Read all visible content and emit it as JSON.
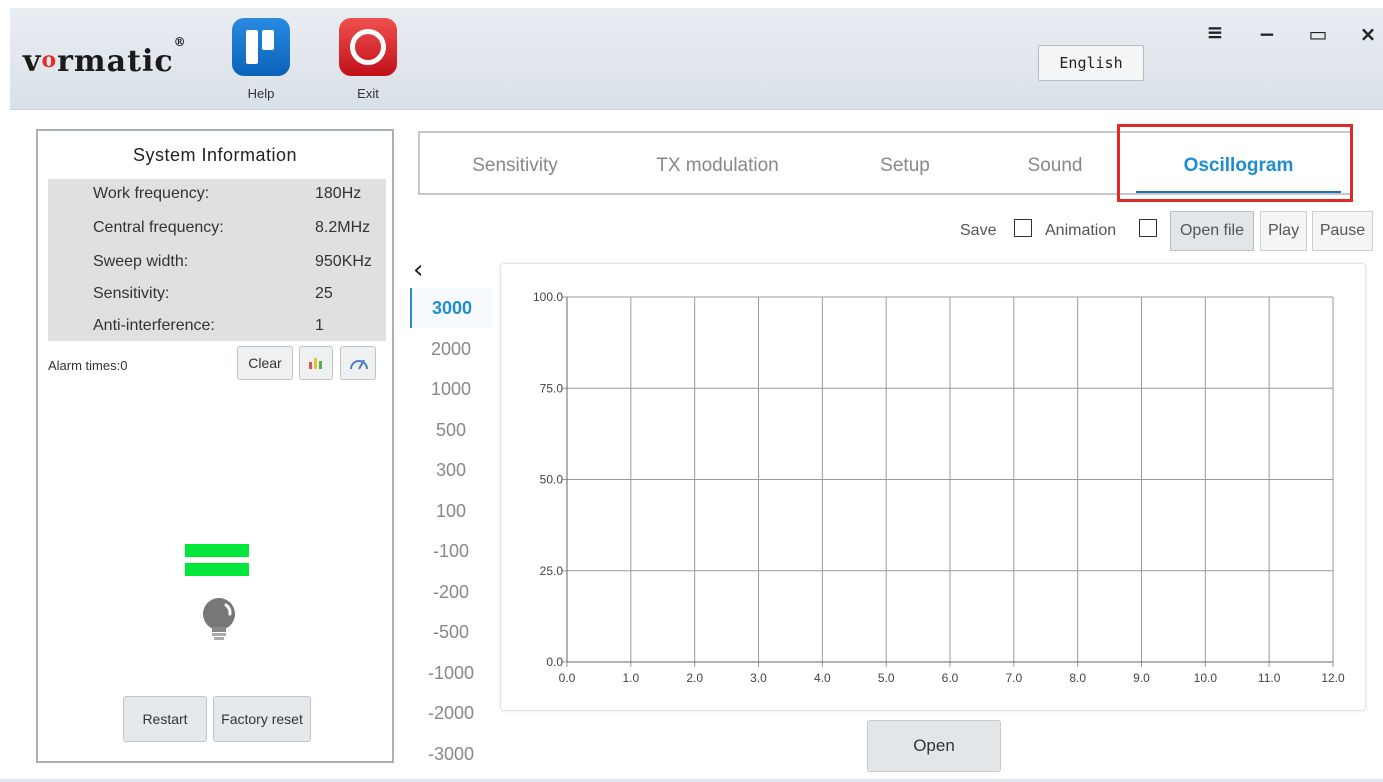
{
  "brand": {
    "logo_text": "vormatic",
    "logo_dot": "o",
    "logo_mark": "®"
  },
  "header": {
    "help_label": "Help",
    "exit_label": "Exit",
    "language": "English",
    "menu_icon": "≡",
    "minimize_icon": "−",
    "maximize_icon": "▭",
    "close_icon": "×"
  },
  "system_info": {
    "title": "System Information",
    "rows": [
      {
        "label": "Work frequency:",
        "value": "180Hz"
      },
      {
        "label": "Central frequency:",
        "value": "8.2MHz"
      },
      {
        "label": "Sweep width:",
        "value": "950KHz"
      },
      {
        "label": "Sensitivity:",
        "value": "25"
      },
      {
        "label": "Anti-interference:",
        "value": "1"
      }
    ],
    "alarm_times": "Alarm times:0",
    "clear_label": "Clear",
    "status_indicator_color": "#00e63a",
    "restart_label": "Restart",
    "factory_reset_label": "Factory reset"
  },
  "tabs": [
    {
      "label": "Sensitivity",
      "active": false
    },
    {
      "label": "TX modulation",
      "active": false
    },
    {
      "label": "Setup",
      "active": false
    },
    {
      "label": "Sound",
      "active": false
    },
    {
      "label": "Oscillogram",
      "active": true
    }
  ],
  "controls": {
    "save_label": "Save",
    "animation_label": "Animation",
    "open_file_label": "Open file",
    "play_label": "Play",
    "pause_label": "Pause",
    "open_label": "Open",
    "back_icon": "‹"
  },
  "frequency_list": [
    "3000",
    "2000",
    "1000",
    "500",
    "300",
    "100",
    "-100",
    "-200",
    "-500",
    "-1000",
    "-2000",
    "-3000"
  ],
  "frequency_active_index": 0,
  "accent_color": "#1d8fd0",
  "chart_data": {
    "type": "line",
    "x_ticks": [
      "0.0",
      "1.0",
      "2.0",
      "3.0",
      "4.0",
      "5.0",
      "6.0",
      "7.0",
      "8.0",
      "9.0",
      "10.0",
      "11.0",
      "12.0"
    ],
    "y_ticks": [
      "0.0",
      "25.0",
      "50.0",
      "75.0",
      "100.0"
    ],
    "xlim": [
      0,
      12
    ],
    "ylim": [
      0,
      100
    ],
    "grid": true,
    "series": []
  }
}
